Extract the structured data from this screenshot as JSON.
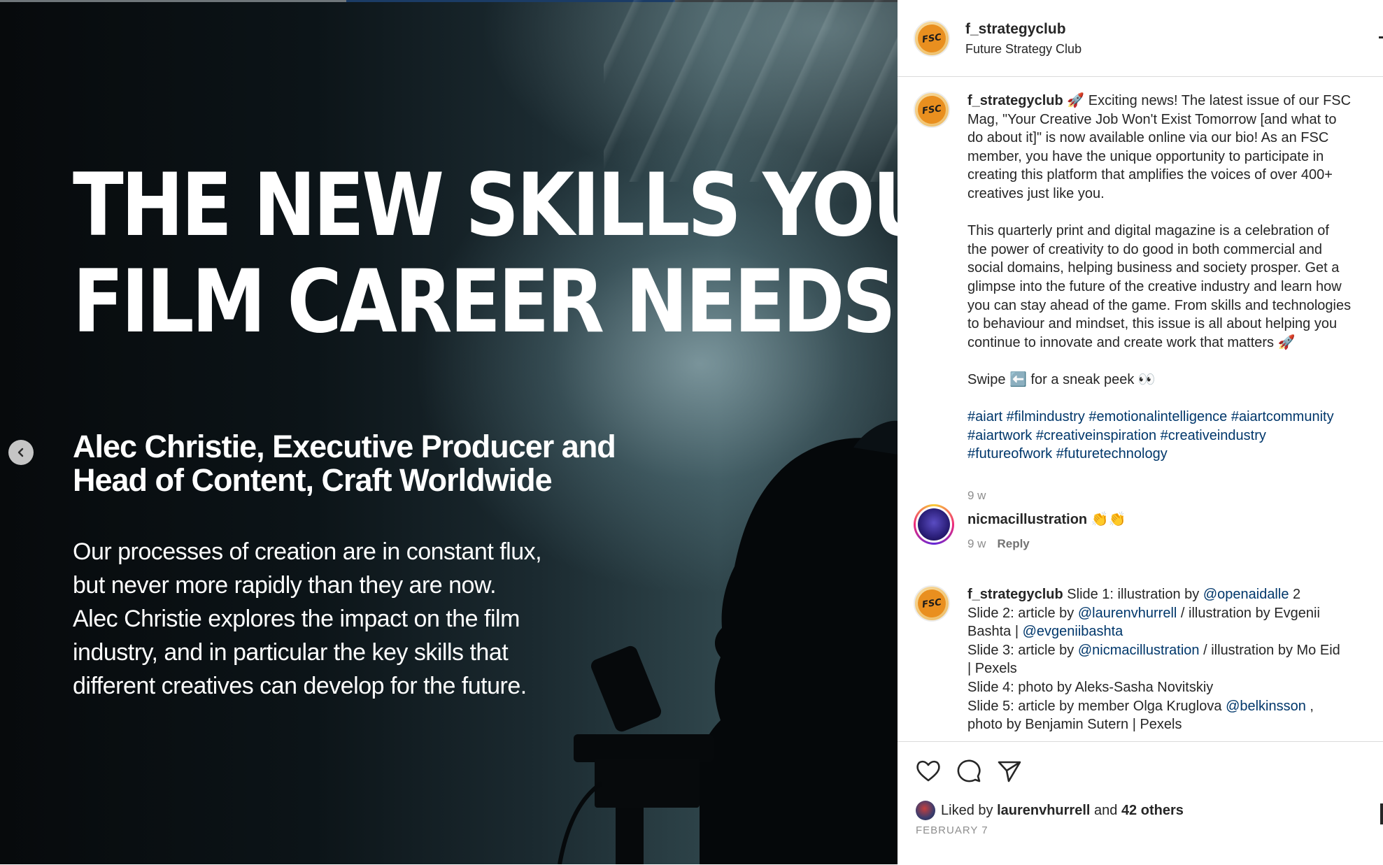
{
  "post_image": {
    "headline_lines": [
      "THE NEW SKILLS YOUR",
      "FILM CAREER NEEDS"
    ],
    "subheadline_lines": [
      "Alec Christie, Executive Producer and",
      "Head of Content, Craft Worldwide"
    ],
    "intro_lines": [
      "Our processes of creation are in constant flux,",
      "but never more rapidly than they are now.",
      "Alec Christie explores the impact on the film",
      "industry, and in particular the key skills that",
      "different creatives can develop for the future."
    ],
    "prev_icon": "chevron-left-icon"
  },
  "header": {
    "username": "f_strategyclub",
    "subtitle": "Future Strategy Club",
    "avatar_text": "FSC"
  },
  "caption": {
    "username": "f_strategyclub",
    "para1_lines": [
      "🚀 Exciting news! The latest issue of our FSC",
      "Mag, \"Your Creative Job Won't Exist Tomorrow [and what to",
      "do about it]\" is now available online via our bio! As an FSC",
      "member, you have the unique opportunity to participate in",
      "creating this platform that amplifies the voices of over 400+",
      "creatives just like you."
    ],
    "para2_lines": [
      "This quarterly print and digital magazine is a celebration of",
      "the power of creativity to do good in both commercial and",
      "social domains, helping business and society prosper. Get a",
      "glimpse into the future of the creative industry and learn how",
      "you can stay ahead of the game. From skills and technologies",
      "to behaviour and mindset, this issue is all about helping you",
      "continue to innovate and create work that matters 🚀"
    ],
    "swipe_line": "Swipe ⬅️ for a sneak peek 👀",
    "hashtag_lines": [
      "#aiart #filmindustry #emotionalintelligence #aiartcommunity",
      "#aiartwork #creativeinspiration #creativeindustry",
      "#futureofwork #futuretechnology"
    ],
    "time": "9 w"
  },
  "comment_nicm": {
    "username": "nicmacillustration",
    "text": "👏👏",
    "time": "9 w",
    "reply_label": "Reply"
  },
  "comment_credits": {
    "username": "f_strategyclub",
    "l1_pre": "Slide 1: illustration by ",
    "l1_tag": "@openaidalle",
    "l1_post": " 2",
    "l2_pre": "Slide 2: article by ",
    "l2_tag": "@laurenvhurrell",
    "l2_post": " / illustration by Evgenii",
    "l3_pre": "Bashta | ",
    "l3_tag": "@evgeniibashta",
    "l4_pre": "Slide 3: article by ",
    "l4_tag": "@nicmacillustration",
    "l4_post": " / illustration by Mo Eid",
    "l5": "| Pexels",
    "l6": "Slide 4: photo by Aleks-Sasha Novitskiy",
    "l7_pre": "Slide 5: article by member Olga Kruglova ",
    "l7_tag": "@belkinsson",
    "l7_post": " ,",
    "l8": "photo by Benjamin Sutern | Pexels"
  },
  "actions": {
    "icons": [
      "heart-icon",
      "comment-icon",
      "share-icon"
    ],
    "liked_prefix": "Liked by ",
    "liked_user": "laurenvhurrell",
    "liked_and": " and ",
    "liked_others": "42 others",
    "date": "FEBRUARY 7"
  },
  "colors": {
    "text": "#262626",
    "muted": "#8e8e8e",
    "hashtag": "#00376b",
    "divider": "#dbdbdb"
  }
}
